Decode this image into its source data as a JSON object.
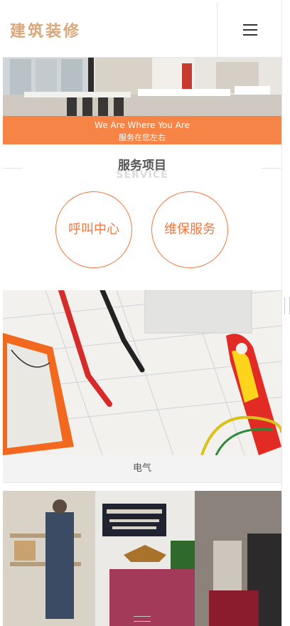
{
  "header": {
    "logo_text": "建筑装修",
    "menu_icon": "hamburger-menu-icon"
  },
  "banner": {
    "tagline_en": "We Are Where You Are",
    "tagline_cn": "服务在您左右"
  },
  "service": {
    "title": "服务项目",
    "subtitle": "SERVICE",
    "buttons": [
      {
        "label": "呼叫中心"
      },
      {
        "label": "维保服务"
      }
    ]
  },
  "products": [
    {
      "caption": "电气"
    }
  ],
  "colors": {
    "accent": "#f58446",
    "circle": "#f2763e",
    "logo": "#d9a77a"
  }
}
